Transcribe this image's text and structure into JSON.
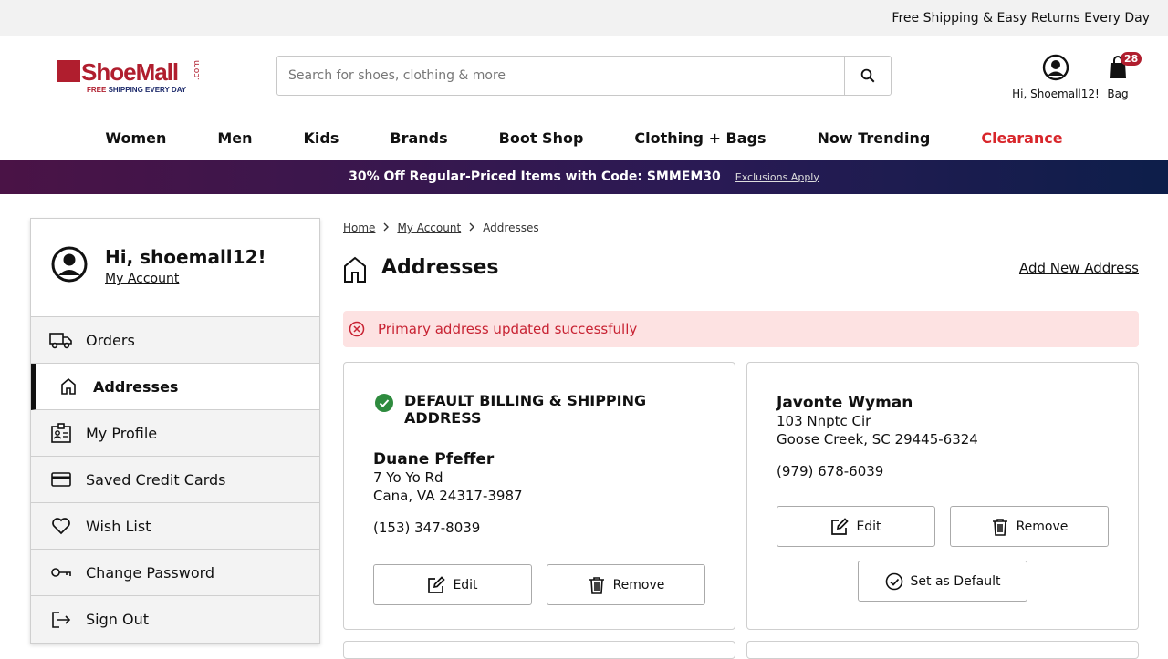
{
  "topbar": {
    "text": "Free Shipping & Easy Returns Every Day"
  },
  "header": {
    "logo_text": "ShoeMall",
    "logo_dotcom": ".com",
    "logo_tag_free": "FREE",
    "logo_tag_rest": " SHIPPING EVERY DAY",
    "search_placeholder": "Search for shoes, clothing & more",
    "account_label": "Hi, Shoemall12!",
    "bag_label": "Bag",
    "bag_count": "28"
  },
  "nav": {
    "items": [
      "Women",
      "Men",
      "Kids",
      "Brands",
      "Boot Shop",
      "Clothing + Bags",
      "Now Trending"
    ],
    "clearance": "Clearance"
  },
  "promo": {
    "text": "30% Off Regular-Priced Items with Code: SMMEM30",
    "link": "Exclusions Apply"
  },
  "sidebar": {
    "greeting": "Hi, shoemall12!",
    "account_link": "My Account",
    "items": [
      {
        "label": "Orders",
        "icon": "truck-icon"
      },
      {
        "label": "Addresses",
        "icon": "home-icon"
      },
      {
        "label": "My Profile",
        "icon": "profile-icon"
      },
      {
        "label": "Saved Credit Cards",
        "icon": "credit-card-icon"
      },
      {
        "label": "Wish List",
        "icon": "heart-icon"
      },
      {
        "label": "Change Password",
        "icon": "key-icon"
      },
      {
        "label": "Sign Out",
        "icon": "sign-out-icon"
      }
    ]
  },
  "breadcrumb": {
    "home": "Home",
    "account": "My Account",
    "current": "Addresses"
  },
  "page": {
    "title": "Addresses",
    "add_link": "Add New Address",
    "alert": "Primary address updated successfully"
  },
  "addresses": [
    {
      "default_label": "DEFAULT BILLING & SHIPPING ADDRESS",
      "name": "Duane Pfeffer",
      "line1": "7 Yo Yo Rd",
      "line2": "Cana, VA 24317-3987",
      "phone": "(153) 347-8039",
      "edit": "Edit",
      "remove": "Remove"
    },
    {
      "name": "Javonte Wyman",
      "line1": "103 Nnptc Cir",
      "line2": "Goose Creek, SC 29445-6324",
      "phone": "(979) 678-6039",
      "edit": "Edit",
      "remove": "Remove",
      "set_default": "Set as Default"
    }
  ]
}
